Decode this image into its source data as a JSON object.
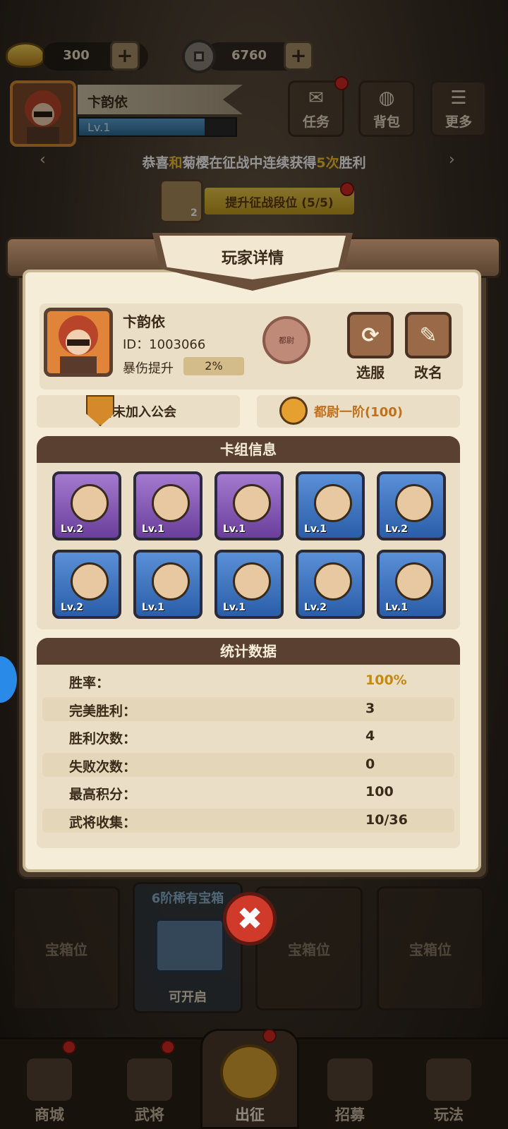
{
  "resources": {
    "gold": "300",
    "copper": "6760",
    "plus": "+"
  },
  "player_top": {
    "name": "卞韵依",
    "level": "Lv.1"
  },
  "top_buttons": [
    {
      "label": "任务",
      "icon": "scroll-icon"
    },
    {
      "label": "背包",
      "icon": "bag-icon"
    },
    {
      "label": "更多",
      "icon": "menu-icon"
    }
  ],
  "notice": {
    "p1": "恭喜",
    "p2": "和",
    "p3": "菊樱",
    "p4": "在征战中连续获得",
    "p5": "5次",
    "p6": "胜利"
  },
  "promo": {
    "label": "提升征战段位 (5/5)",
    "count": "2"
  },
  "modal": {
    "title": "玩家详情",
    "player": {
      "name": "卞韵依",
      "id": "ID：1003066",
      "crit_label": "暴伤提升",
      "crit_value": "2%",
      "rank_badge": "都尉"
    },
    "actions": [
      {
        "label": "选服",
        "icon": "refresh-icon"
      },
      {
        "label": "改名",
        "icon": "pencil-icon"
      }
    ],
    "guild": "暂未加入公会",
    "rank": "都尉一阶(100)",
    "deck": {
      "title": "卡组信息",
      "heroes": [
        {
          "lv": "Lv.2",
          "rarity": "purple"
        },
        {
          "lv": "Lv.1",
          "rarity": "purple"
        },
        {
          "lv": "Lv.1",
          "rarity": "purple"
        },
        {
          "lv": "Lv.1",
          "rarity": "blue"
        },
        {
          "lv": "Lv.2",
          "rarity": "blue"
        },
        {
          "lv": "Lv.2",
          "rarity": "blue"
        },
        {
          "lv": "Lv.1",
          "rarity": "blue"
        },
        {
          "lv": "Lv.1",
          "rarity": "blue"
        },
        {
          "lv": "Lv.2",
          "rarity": "blue"
        },
        {
          "lv": "Lv.1",
          "rarity": "blue"
        }
      ]
    },
    "stats": {
      "title": "统计数据",
      "rows": [
        {
          "k": "胜率：",
          "v": "100%"
        },
        {
          "k": "完美胜利：",
          "v": "3"
        },
        {
          "k": "胜利次数：",
          "v": "4"
        },
        {
          "k": "失败次数：",
          "v": "0"
        },
        {
          "k": "最高积分：",
          "v": "100"
        },
        {
          "k": "武将收集：",
          "v": "10/36"
        }
      ]
    }
  },
  "chests": {
    "slot": "宝箱位",
    "rare_title": "6阶稀有宝箱",
    "rare_status": "可开启"
  },
  "close_symbol": "✖",
  "nav": [
    {
      "label": "商城"
    },
    {
      "label": "武将"
    },
    {
      "label": "出征"
    },
    {
      "label": "招募"
    },
    {
      "label": "玩法"
    }
  ]
}
